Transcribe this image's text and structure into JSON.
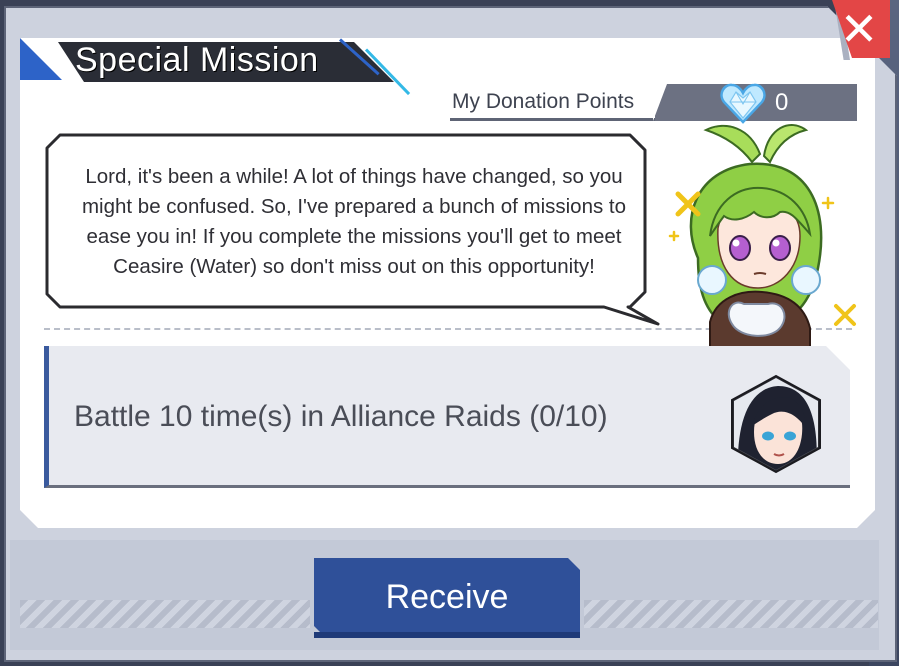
{
  "dialog": {
    "title": "Special Mission",
    "close_symbol": "✕"
  },
  "donation": {
    "label": "My Donation Points",
    "value": "0",
    "icon": "diamond-heart-icon"
  },
  "speech": {
    "lines": [
      "Lord, it's been a while! A lot of things have changed, so you",
      "might be confused. So, I've prepared a bunch of missions to",
      "ease you in! If you complete the missions you'll get to meet",
      "Ceasire (Water) so don't miss out on this opportunity!"
    ]
  },
  "mission": {
    "text": "Battle 10 time(s) in Alliance Raids (0/10)",
    "progress": {
      "current": 0,
      "total": 10
    }
  },
  "buttons": {
    "receive": "Receive"
  },
  "colors": {
    "title_banner": "#2a2d36",
    "accent_blue": "#2d63c8",
    "accent_cyan": "#33b9e6",
    "close_red": "#e34646",
    "button_blue": "#2f5099",
    "mission_bar": "#3a5a9e"
  }
}
